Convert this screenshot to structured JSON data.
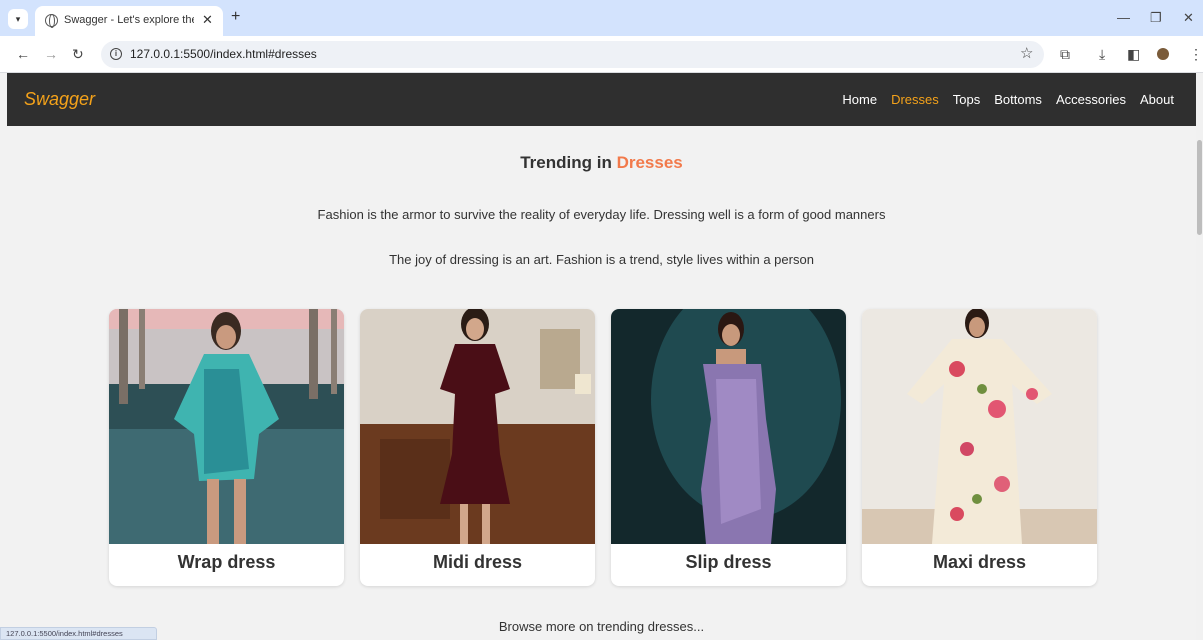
{
  "browser": {
    "tab_title": "Swagger - Let's explore the trending",
    "tab_close": "✕",
    "new_tab": "+",
    "url": "127.0.0.1:5500/index.html#dresses",
    "status_url": "127.0.0.1:5500/index.html#dresses",
    "icons": [
      "tab-menu-icon",
      "globe-icon",
      "close-icon",
      "plus-icon",
      "minimize-icon",
      "restore-icon",
      "window-close-icon",
      "back-icon",
      "forward-icon",
      "reload-icon",
      "info-icon",
      "star-icon",
      "extensions-icon",
      "download-icon",
      "sidepanel-icon",
      "profile-icon",
      "kebab-menu-icon"
    ]
  },
  "site": {
    "brand": "Swagger",
    "nav": [
      {
        "label": "Home",
        "active": false
      },
      {
        "label": "Dresses",
        "active": true
      },
      {
        "label": "Tops",
        "active": false
      },
      {
        "label": "Bottoms",
        "active": false
      },
      {
        "label": "Accessories",
        "active": false
      },
      {
        "label": "About",
        "active": false
      }
    ]
  },
  "content": {
    "heading_prefix": "Trending in ",
    "heading_highlight": "Dresses",
    "quotes": [
      "Fashion is the armor to survive the reality of everyday life. Dressing well is a form of good manners",
      "The joy of dressing is an art. Fashion is a trend, style lives within a person"
    ],
    "cards": [
      {
        "title": "Wrap dress"
      },
      {
        "title": "Midi dress"
      },
      {
        "title": "Slip dress"
      },
      {
        "title": "Maxi dress"
      }
    ],
    "browse_more": "Browse more on trending dresses..."
  },
  "colors": {
    "accent": "#f4a21a",
    "heading_highlight": "#f27a4b",
    "navbar_bg": "#2f2f2f",
    "page_bg": "#f2f2f2",
    "tabstrip_bg": "#d3e3fd"
  }
}
